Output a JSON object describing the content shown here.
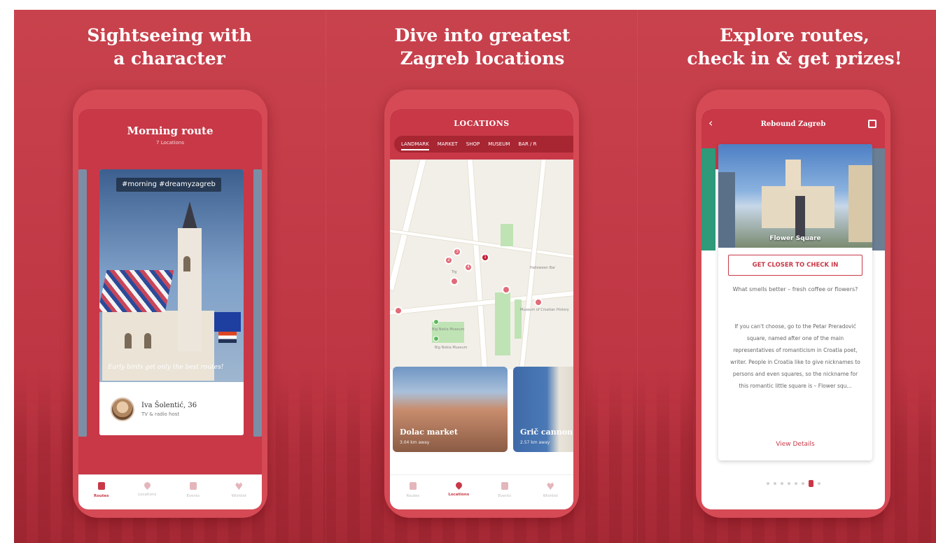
{
  "colors": {
    "brand": "#c83847",
    "background": "#c13845",
    "accent_green": "#5cb85c"
  },
  "panels": {
    "left": {
      "headline": [
        "Sightseeing with",
        "a character"
      ]
    },
    "center": {
      "headline": [
        "Dive into greatest",
        "Zagreb locations"
      ]
    },
    "right": {
      "headline": [
        "Explore routes,",
        "check in & get prizes!"
      ]
    }
  },
  "phone1": {
    "title": "Morning route",
    "subtitle": "7 Locations",
    "hashtag": "#morning #dreamyzagreb",
    "caption": "Early birds get only the best routes!",
    "author": {
      "name": "Iva Šolentić, 36",
      "role": "TV & radio host"
    },
    "tabbar": [
      {
        "label": "Routes",
        "icon": "route-icon",
        "active": true
      },
      {
        "label": "Locations",
        "icon": "location-pin-icon",
        "active": false
      },
      {
        "label": "Events",
        "icon": "calendar-icon",
        "active": false
      },
      {
        "label": "Wishlist",
        "icon": "heart-icon",
        "active": false
      }
    ]
  },
  "phone2": {
    "title": "LOCATIONS",
    "tabs": [
      "LANDMARK",
      "MARKET",
      "SHOP",
      "MUSEUM",
      "BAR / R"
    ],
    "active_tab": "LANDMARK",
    "map_labels": [
      "Trg",
      "Big Nokia Museum",
      "Big Nokia Museum",
      "Halloween Bar",
      "Museum of Croatian History"
    ],
    "markers": [
      "2",
      "3",
      "4",
      "1"
    ],
    "places": [
      {
        "name": "Dolac market",
        "distance": "3.04 km away"
      },
      {
        "name": "Grič cannon",
        "distance": "2.57 km away"
      }
    ],
    "tabbar": [
      {
        "label": "Routes",
        "icon": "route-icon",
        "active": false
      },
      {
        "label": "Locations",
        "icon": "location-pin-icon",
        "active": true
      },
      {
        "label": "Events",
        "icon": "calendar-icon",
        "active": false
      },
      {
        "label": "Wishlist",
        "icon": "heart-icon",
        "active": false
      }
    ]
  },
  "phone3": {
    "title": "Rebound Zagreb",
    "photo_label": "Flower Square",
    "checkin_label": "GET CLOSER TO CHECK IN",
    "question": "What smells better – fresh coffee or flowers?",
    "body": "If you can't choose, go to the Petar Preradović square, named after one of the main representatives of romanticism in Croatia poet, writer. People in Croatia like to give nicknames to persons and even squares, so the nickname for this romantic little square is – Flower squ...",
    "view_details": "View Details",
    "pagination": {
      "total": 8,
      "current": 7
    }
  }
}
